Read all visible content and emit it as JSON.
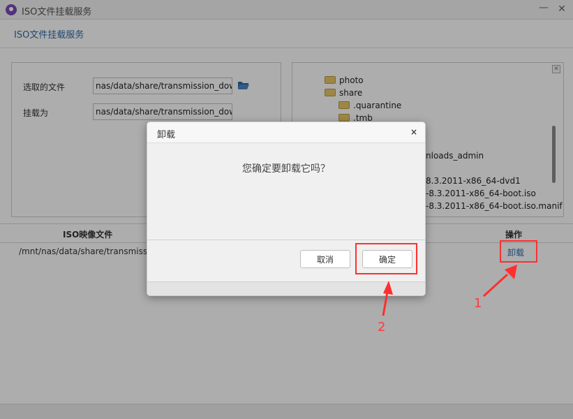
{
  "window": {
    "title": "ISO文件挂载服务",
    "minimize_glyph": "—",
    "close_glyph": "✕"
  },
  "header": {
    "title": "ISO文件挂载服务"
  },
  "form": {
    "selected_file_label": "选取的文件",
    "selected_file_value": "nas/data/share/transmission_down",
    "mount_as_label": "挂载为",
    "mount_as_value": "nas/data/share/transmission_down"
  },
  "tree": {
    "items": [
      {
        "label": "photo"
      },
      {
        "label": "share"
      },
      {
        "label": ".quarantine"
      },
      {
        "label": ".tmb"
      },
      {
        "label": "nloads_admin"
      },
      {
        "label": "8.3.2011-x86_64-dvd1"
      },
      {
        "label": "-8.3.2011-x86_64-boot.iso"
      },
      {
        "label": "-8.3.2011-x86_64-boot.iso.manif"
      }
    ]
  },
  "table": {
    "columns": {
      "iso": "ISO映像文件",
      "action": "操作"
    },
    "rows": [
      {
        "path": "/mnt/nas/data/share/transmissi",
        "action": "卸载"
      }
    ]
  },
  "dialog": {
    "title": "卸载",
    "close_glyph": "×",
    "message": "您确定要卸载它吗？",
    "cancel_label": "取消",
    "confirm_label": "确定"
  },
  "annotations": {
    "label_1": "1",
    "label_2": "2",
    "color": "#ff2f2f"
  }
}
